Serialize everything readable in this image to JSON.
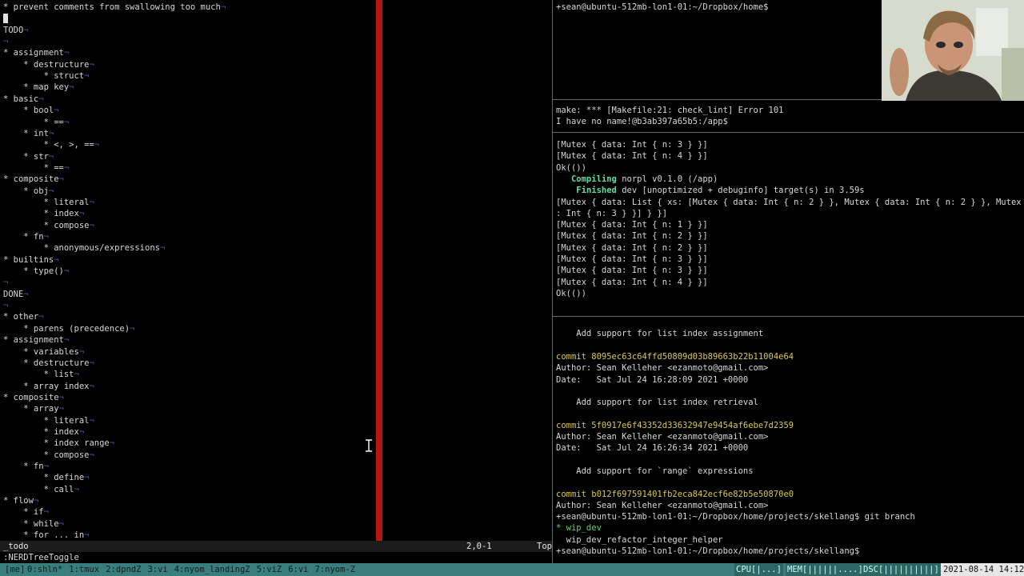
{
  "vim": {
    "lines": [
      {
        "text": "* prevent comments from swallowing too much",
        "eol": "¬"
      },
      {
        "text": "",
        "eol": "¬"
      },
      {
        "text": "TODO",
        "eol": "¬"
      },
      {
        "text": "",
        "eol": "¬"
      },
      {
        "text": "* assignment",
        "eol": "¬"
      },
      {
        "text": "    * destructure",
        "eol": "¬"
      },
      {
        "text": "        * struct",
        "eol": "¬"
      },
      {
        "text": "    * map key",
        "eol": "¬"
      },
      {
        "text": "* basic",
        "eol": "¬"
      },
      {
        "text": "    * bool",
        "eol": "¬"
      },
      {
        "text": "        * ==",
        "eol": "¬"
      },
      {
        "text": "    * int",
        "eol": "¬"
      },
      {
        "text": "        * <, >, ==",
        "eol": "¬"
      },
      {
        "text": "    * str",
        "eol": "¬"
      },
      {
        "text": "        * ==",
        "eol": "¬"
      },
      {
        "text": "* composite",
        "eol": "¬"
      },
      {
        "text": "    * obj",
        "eol": "¬"
      },
      {
        "text": "        * literal",
        "eol": "¬"
      },
      {
        "text": "        * index",
        "eol": "¬"
      },
      {
        "text": "        * compose",
        "eol": "¬"
      },
      {
        "text": "    * fn",
        "eol": "¬"
      },
      {
        "text": "        * anonymous/expressions",
        "eol": "¬"
      },
      {
        "text": "* builtins",
        "eol": "¬"
      },
      {
        "text": "    * type()",
        "eol": "¬"
      },
      {
        "text": "",
        "eol": "¬"
      },
      {
        "text": "DONE",
        "eol": "¬"
      },
      {
        "text": "",
        "eol": "¬"
      },
      {
        "text": "* other",
        "eol": "¬"
      },
      {
        "text": "    * parens (precedence)",
        "eol": "¬"
      },
      {
        "text": "* assignment",
        "eol": "¬"
      },
      {
        "text": "    * variables",
        "eol": "¬"
      },
      {
        "text": "    * destructure",
        "eol": "¬"
      },
      {
        "text": "        * list",
        "eol": "¬"
      },
      {
        "text": "    * array index",
        "eol": "¬"
      },
      {
        "text": "* composite",
        "eol": "¬"
      },
      {
        "text": "    * array",
        "eol": "¬"
      },
      {
        "text": "        * literal",
        "eol": "¬"
      },
      {
        "text": "        * index",
        "eol": "¬"
      },
      {
        "text": "        * index range",
        "eol": "¬"
      },
      {
        "text": "        * compose",
        "eol": "¬"
      },
      {
        "text": "    * fn",
        "eol": "¬"
      },
      {
        "text": "        * define",
        "eol": "¬"
      },
      {
        "text": "        * call",
        "eol": "¬"
      },
      {
        "text": "* flow",
        "eol": "¬"
      },
      {
        "text": "    * if",
        "eol": "¬"
      },
      {
        "text": "    * while",
        "eol": "¬"
      },
      {
        "text": "    * for ... in",
        "eol": "¬"
      }
    ],
    "statusline": {
      "filename": "_todo",
      "position": "2,0-1",
      "scroll": "Top"
    },
    "cmdline": ":NERDTreeToggle"
  },
  "pane1": {
    "lines": [
      "+sean@ubuntu-512mb-lon1-01:~/Dropbox/home$"
    ]
  },
  "pane2": {
    "lines": [
      "make: *** [Makefile:21: check_lint] Error 101",
      "I have no name!@b3ab397a65b5:/app$"
    ]
  },
  "pane3": {
    "lines": [
      {
        "text": "[Mutex { data: Int { n: 3 } }]"
      },
      {
        "text": "[Mutex { data: Int { n: 4 } }]"
      },
      {
        "text": "Ok(())"
      },
      {
        "pre": "   ",
        "strong": "Compiling",
        "text": " norpl v0.1.0 (/app)"
      },
      {
        "pre": "    ",
        "strong": "Finished",
        "text": " dev [unoptimized + debuginfo] target(s) in 3.59s"
      },
      {
        "text": "[Mutex { data: List { xs: [Mutex { data: Int { n: 2 } }, Mutex { data: Int { n: 2 } }, Mutex { data"
      },
      {
        "text": ": Int { n: 3 } }] } }]"
      },
      {
        "text": "[Mutex { data: Int { n: 1 } }]"
      },
      {
        "text": "[Mutex { data: Int { n: 2 } }]"
      },
      {
        "text": "[Mutex { data: Int { n: 2 } }]"
      },
      {
        "text": "[Mutex { data: Int { n: 3 } }]"
      },
      {
        "text": "[Mutex { data: Int { n: 3 } }]"
      },
      {
        "text": "[Mutex { data: Int { n: 4 } }]"
      },
      {
        "text": "Ok(())"
      }
    ]
  },
  "pane4": {
    "lines": [
      {
        "text": ""
      },
      {
        "text": "    Add support for list index assignment"
      },
      {
        "text": ""
      },
      {
        "commit": "commit 8095ec63c64ffd50809d03b89663b22b11004e64"
      },
      {
        "text": "Author: Sean Kelleher <ezanmoto@gmail.com>"
      },
      {
        "text": "Date:   Sat Jul 24 16:28:09 2021 +0000"
      },
      {
        "text": ""
      },
      {
        "text": "    Add support for list index retrieval"
      },
      {
        "text": ""
      },
      {
        "commit": "commit 5f0917e6f43352d33632947e9454af6ebe7d2359"
      },
      {
        "text": "Author: Sean Kelleher <ezanmoto@gmail.com>"
      },
      {
        "text": "Date:   Sat Jul 24 16:26:34 2021 +0000"
      },
      {
        "text": ""
      },
      {
        "text": "    Add support for `range` expressions"
      },
      {
        "text": ""
      },
      {
        "commit": "commit b012f697591401fb2eca842ecf6e82b5e50870e0"
      },
      {
        "text": "Author: Sean Kelleher <ezanmoto@gmail.com>"
      },
      {
        "text": "+sean@ubuntu-512mb-lon1-01:~/Dropbox/home/projects/skellang$ git branch"
      },
      {
        "branch": "* wip_dev"
      },
      {
        "text": "  wip_dev_refactor_integer_helper"
      },
      {
        "text": "+sean@ubuntu-512mb-lon1-01:~/Dropbox/home/projects/skellang$"
      }
    ]
  },
  "tmux": {
    "session": "[me]",
    "windows": [
      "0:shln*",
      "1:tmux",
      "2:dpndZ",
      "3:vi",
      "4:nyom_landingZ",
      "5:viZ",
      "6:vi",
      "7:nyom-Z"
    ],
    "cpu": "CPU[|...]",
    "mem": "MEM[||||||....]",
    "dsc": "DSC[||||||||||]",
    "datetime": "2021-08-14 14:12"
  },
  "colors": {
    "accent_red": "#b3170f",
    "tmux_bar": "#3a7d7d",
    "rust_green": "#5ee0a0",
    "commit_yellow": "#d9c84f",
    "branch_green": "#6bd16b",
    "eol_blue": "#4a5aa8"
  }
}
